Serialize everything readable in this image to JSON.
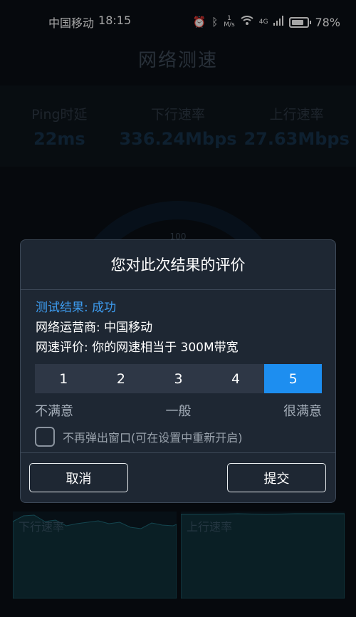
{
  "status_bar": {
    "carrier": "中国移动",
    "time": "18:15",
    "speed_value": "1",
    "speed_unit": "M/s",
    "network": "4G",
    "battery": "78%"
  },
  "page": {
    "title": "网络测速"
  },
  "stats": [
    {
      "label": "Ping时延",
      "value": "22ms"
    },
    {
      "label": "下行速率",
      "value": "336.24Mbps"
    },
    {
      "label": "上行速率",
      "value": "27.63Mbps"
    }
  ],
  "gauge": {
    "tick_label": "100"
  },
  "mini_charts": {
    "download_label": "下行速率",
    "upload_label": "上行速率"
  },
  "dialog": {
    "title": "您对此次结果的评价",
    "result_status": "测试结果: 成功",
    "carrier_line": "网络运营商:  中国移动",
    "rating_line": "网速评价:  你的网速相当于 300M带宽",
    "rating_options": [
      "1",
      "2",
      "3",
      "4",
      "5"
    ],
    "selected_rating": "5",
    "scale_low": "不满意",
    "scale_mid": "一般",
    "scale_high": "很满意",
    "checkbox_label": "不再弹出窗口(可在设置中重新开启)",
    "cancel_label": "取消",
    "submit_label": "提交"
  },
  "colors": {
    "accent": "#1d8ef0",
    "success_text": "#3d9cf0",
    "dialog_bg": "#1e2733"
  }
}
